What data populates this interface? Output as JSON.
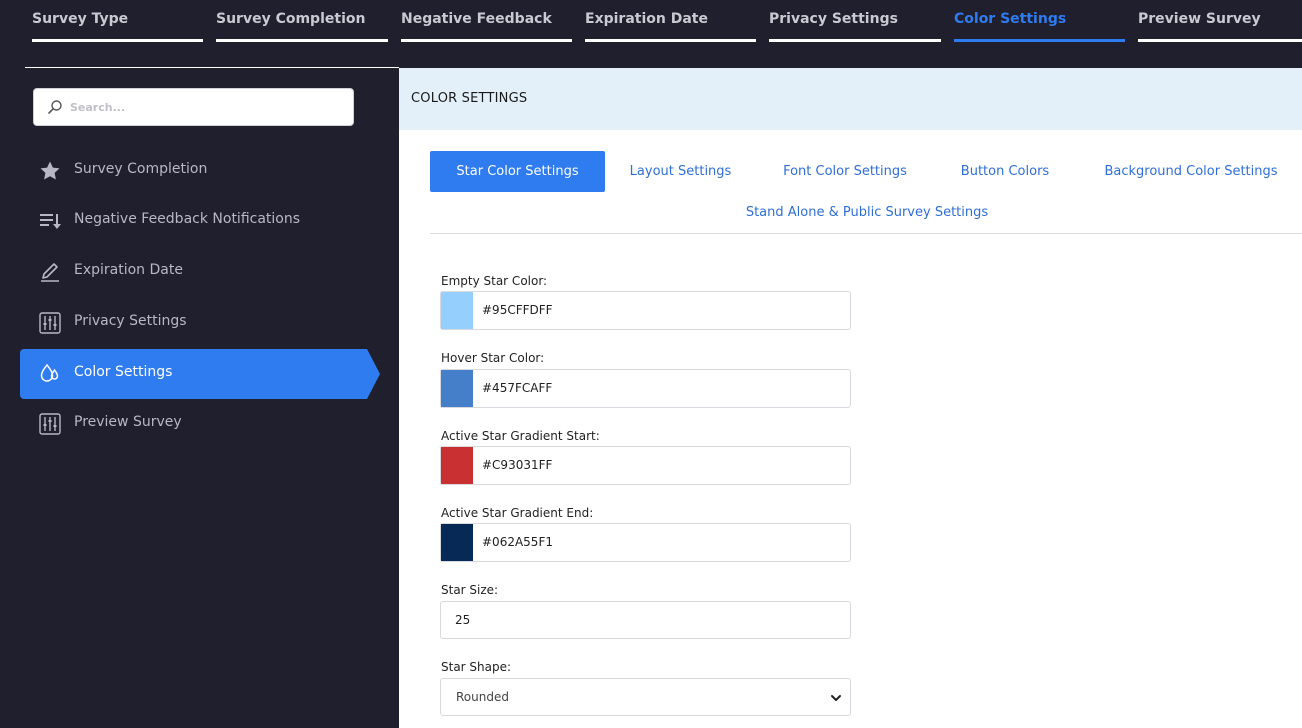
{
  "steps": [
    {
      "label": "Survey Type",
      "active": false
    },
    {
      "label": "Survey Completion",
      "active": false
    },
    {
      "label": "Negative Feedback",
      "active": false
    },
    {
      "label": "Expiration Date",
      "active": false
    },
    {
      "label": "Privacy Settings",
      "active": false
    },
    {
      "label": "Color Settings",
      "active": true
    },
    {
      "label": "Preview Survey",
      "active": false
    }
  ],
  "sidebar": {
    "search_placeholder": "Search...",
    "items": [
      {
        "label": "Survey Completion",
        "icon": "star-icon"
      },
      {
        "label": "Negative Feedback Notifications",
        "icon": "sort-list-icon"
      },
      {
        "label": "Expiration Date",
        "icon": "pencil-icon"
      },
      {
        "label": "Privacy Settings",
        "icon": "sliders-icon"
      },
      {
        "label": "Color Settings",
        "icon": "droplets-icon",
        "active": true
      },
      {
        "label": "Preview Survey",
        "icon": "sliders-icon"
      }
    ]
  },
  "main": {
    "title": "COLOR SETTINGS",
    "tabs": [
      {
        "label": "Star Color Settings",
        "active": true
      },
      {
        "label": "Layout Settings"
      },
      {
        "label": "Font Color Settings"
      },
      {
        "label": "Button Colors"
      },
      {
        "label": "Background Color Settings"
      },
      {
        "label": "Stand Alone & Public Survey Settings"
      }
    ],
    "fields": {
      "empty_star": {
        "label": "Empty Star Color:",
        "value": "#95CFFDFF",
        "swatch": "#95cffd"
      },
      "hover_star": {
        "label": "Hover Star Color:",
        "value": "#457FCAFF",
        "swatch": "#457fca"
      },
      "gradient_start": {
        "label": "Active Star Gradient Start:",
        "value": "#C93031FF",
        "swatch": "#c93031"
      },
      "gradient_end": {
        "label": "Active Star Gradient End:",
        "value": "#062A55F1",
        "swatch": "#062a55"
      },
      "star_size": {
        "label": "Star Size:",
        "value": "25"
      },
      "star_shape": {
        "label": "Star Shape:",
        "value": "Rounded"
      }
    }
  },
  "colors": {
    "accent": "#2f7bf0",
    "sidebar_bg": "#1f1f2e",
    "header_bg": "#e3f0f9"
  }
}
